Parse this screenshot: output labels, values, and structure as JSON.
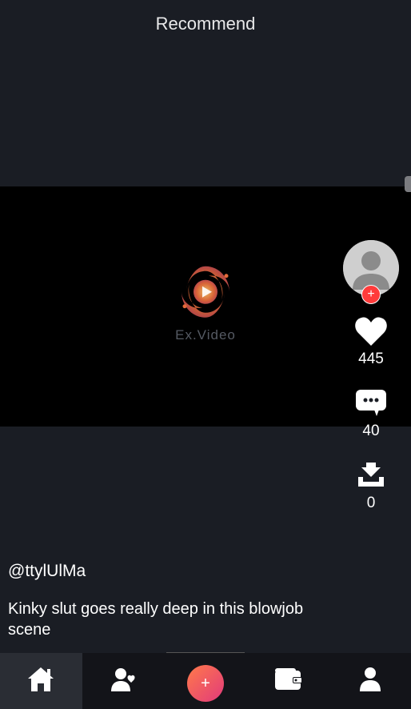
{
  "header": {
    "title": "Recommend"
  },
  "watermark": {
    "text": "Ex.Video"
  },
  "rail": {
    "likes": "445",
    "comments": "40",
    "downloads": "0"
  },
  "post": {
    "username": "@ttylUlMa",
    "caption": "Kinky slut goes really deep in this blowjob scene"
  },
  "nav": {
    "center_glyph": "+"
  },
  "follow_glyph": "+"
}
